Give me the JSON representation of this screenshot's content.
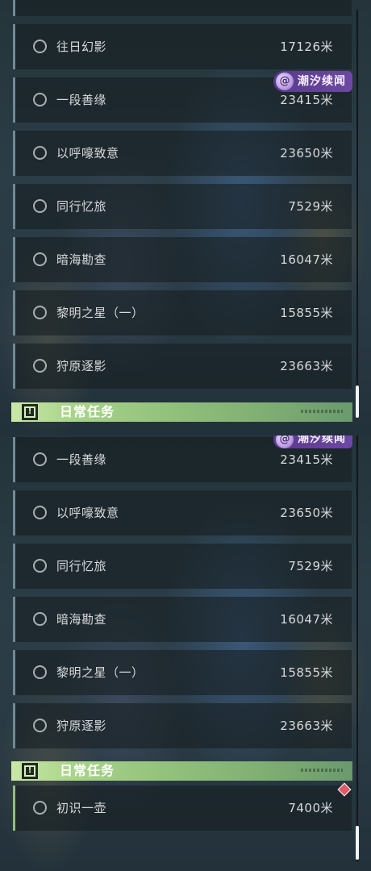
{
  "badge": {
    "label": "潮汐续闻",
    "icon": "spiral-emblem-icon"
  },
  "panel_a": {
    "quests": [
      {
        "name": "往日幻影",
        "distance": "17126米"
      },
      {
        "name": "一段善缘",
        "distance": "23415米"
      },
      {
        "name": "以呼嚎致意",
        "distance": "23650米"
      },
      {
        "name": "同行忆旅",
        "distance": "7529米"
      },
      {
        "name": "暗海勘查",
        "distance": "16047米"
      },
      {
        "name": "黎明之星（一）",
        "distance": "15855米"
      },
      {
        "name": "狩原逐影",
        "distance": "23663米"
      }
    ],
    "section_header": "日常任务"
  },
  "panel_b": {
    "quests": [
      {
        "name": "一段善缘",
        "distance": "23415米"
      },
      {
        "name": "以呼嚎致意",
        "distance": "23650米"
      },
      {
        "name": "同行忆旅",
        "distance": "7529米"
      },
      {
        "name": "暗海勘查",
        "distance": "16047米"
      },
      {
        "name": "黎明之星（一）",
        "distance": "15855米"
      },
      {
        "name": "狩原逐影",
        "distance": "23663米"
      }
    ],
    "section_header": "日常任务",
    "daily_quests": [
      {
        "name": "初识一壶",
        "distance": "7400米"
      }
    ]
  },
  "colors": {
    "header_green": "#a9d48a",
    "badge_purple": "#6c48a2",
    "row_border": "#6f8a96",
    "daily_row_border": "#8fbf7a",
    "marker_red": "#e05a68"
  }
}
